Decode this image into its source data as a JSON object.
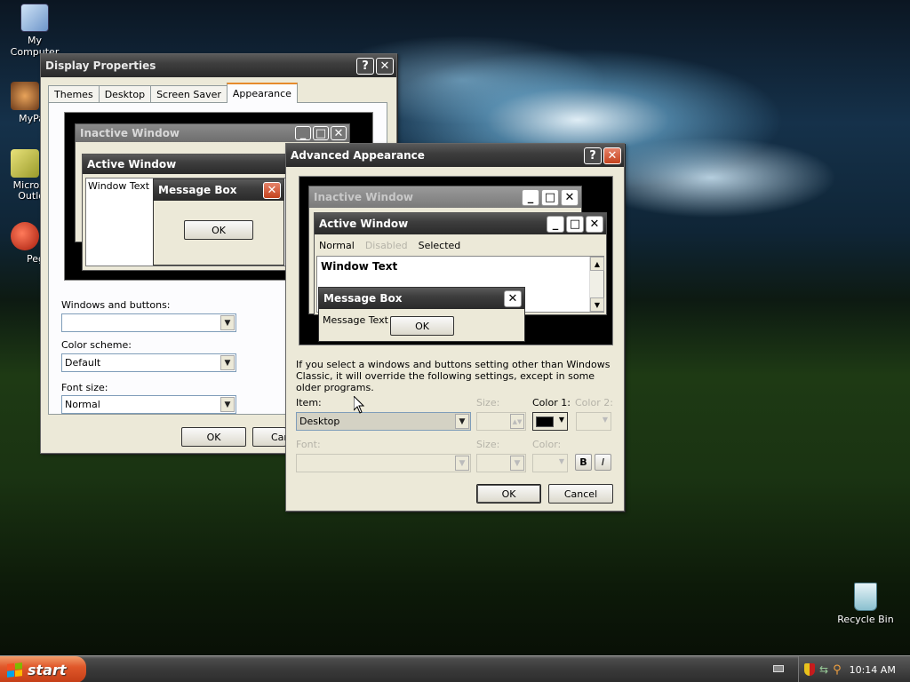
{
  "desktop": {
    "icons": [
      {
        "label": "My Computer"
      },
      {
        "label": "MyPa"
      },
      {
        "label": "Micros Outlo"
      },
      {
        "label": "Peg"
      },
      {
        "label": "Recycle Bin"
      }
    ]
  },
  "display_properties": {
    "title": "Display Properties",
    "tabs": [
      "Themes",
      "Desktop",
      "Screen Saver",
      "Appearance"
    ],
    "active_tab": "Appearance",
    "preview": {
      "inactive_title": "Inactive Window",
      "active_title": "Active Window",
      "window_text": "Window Text",
      "msgbox_title": "Message Box",
      "msgbox_ok": "OK"
    },
    "windows_and_buttons_label": "Windows and buttons:",
    "windows_and_buttons_value": "",
    "color_scheme_label": "Color scheme:",
    "color_scheme_value": "Default",
    "font_size_label": "Font size:",
    "font_size_value": "Normal",
    "ok": "OK",
    "cancel_partial": "Car"
  },
  "advanced_appearance": {
    "title": "Advanced Appearance",
    "preview": {
      "inactive_title": "Inactive Window",
      "active_title": "Active Window",
      "menu_normal": "Normal",
      "menu_disabled": "Disabled",
      "menu_selected": "Selected",
      "window_text": "Window Text",
      "msgbox_title": "Message Box",
      "msgbox_text": "Message Text",
      "msgbox_ok": "OK"
    },
    "note": "If you select a windows and buttons setting other than Windows Classic, it will override the following settings, except in some older programs.",
    "item_label": "Item:",
    "item_value": "Desktop",
    "size_label": "Size:",
    "color1_label": "Color 1:",
    "color1_value": "#000000",
    "color2_label": "Color 2:",
    "font_label": "Font:",
    "font_size_label": "Size:",
    "font_color_label": "Color:",
    "bold_label": "B",
    "italic_label": "I",
    "ok": "OK",
    "cancel": "Cancel"
  },
  "taskbar": {
    "start_label": "start",
    "clock": "10:14 AM"
  },
  "colors": {
    "start_orange": "#e0582a",
    "close_red": "#c4421d",
    "tab_accent": "#e68b2c"
  }
}
